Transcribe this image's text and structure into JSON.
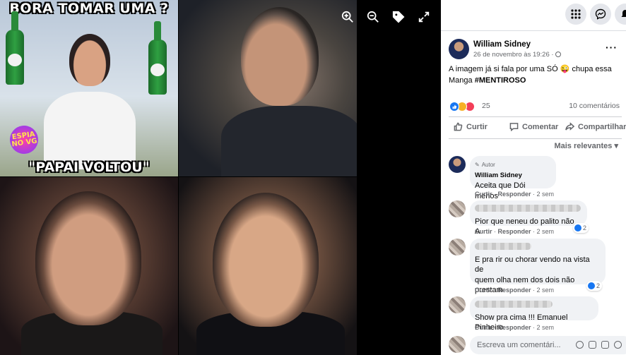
{
  "collage": {
    "meme_top_text": "BORA TOMAR UMA ?",
    "meme_bottom_text": "\"PAPAI VOLTOU\"",
    "logo_text": "ESPIA NO VG"
  },
  "viewer_tools": [
    "zoom-in-icon",
    "zoom-out-icon",
    "tag-icon",
    "fullscreen-icon"
  ],
  "post": {
    "author": "William Sidney",
    "time": "26 de novembro às 19:26 ·",
    "text_line1": "A imagem já si fala por uma SÓ 😜 chupa essa",
    "text_line2_prefix": "Manga ",
    "hashtag": "#MENTIROSO",
    "reaction_count": "25",
    "comment_count": "10 comentários"
  },
  "actions": {
    "like": "Curtir",
    "comment": "Comentar",
    "share": "Compartilhar"
  },
  "sort_label": "Mais relevantes",
  "comments": [
    {
      "badge": "Autor",
      "author": "William Sidney",
      "text": "Aceita que Dói menos",
      "like": "Curtir",
      "reply": "Responder",
      "age": "2 sem",
      "likes": ""
    },
    {
      "author": "",
      "text": "Pior que neneu do palito não A",
      "like": "Curtir",
      "reply": "Responder",
      "age": "2 sem",
      "likes": "2"
    },
    {
      "author": "",
      "text_line1": "E pra rir ou chorar vendo na vista de",
      "text_line2": "quem olha nem dos dois não",
      "text_line3": "prestam",
      "like": "Curtir",
      "reply": "Responder",
      "age": "2 sem",
      "likes": "2"
    },
    {
      "author": "",
      "text": "Show pra cima !!! Emanuel Pinheiro",
      "like": "Curtir",
      "reply": "Responder",
      "age": "2 sem",
      "likes": ""
    }
  ],
  "compose": {
    "placeholder": "Escreva um comentári..."
  },
  "colors": {
    "facebook_blue": "#1877f2",
    "panel_bg": "#ffffff",
    "bubble_bg": "#f0f2f5",
    "secondary_text": "#65676b"
  }
}
